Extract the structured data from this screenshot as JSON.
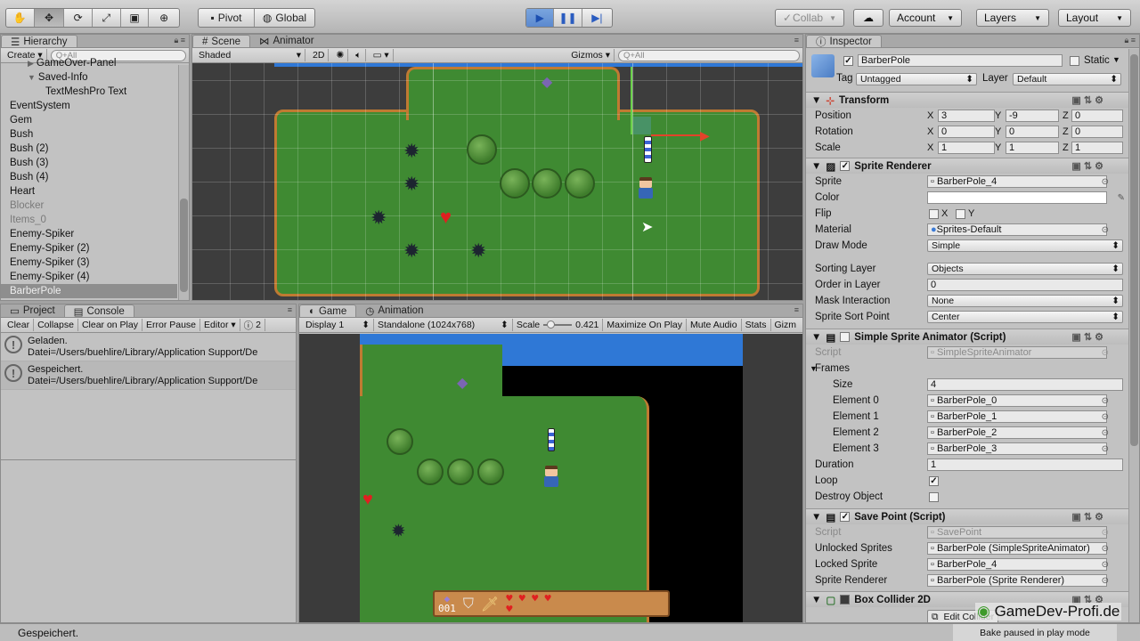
{
  "toolbar": {
    "pivot": "Pivot",
    "global": "Global",
    "collab": "Collab",
    "account": "Account",
    "layers": "Layers",
    "layout": "Layout"
  },
  "hierarchy": {
    "tab": "Hierarchy",
    "create": "Create",
    "search_placeholder": "Q+All",
    "items": [
      {
        "label": "GameOver-Panel",
        "indent": 3,
        "dim": false,
        "selected": false,
        "foldout": "▶"
      },
      {
        "label": "Saved-Info",
        "indent": 3,
        "dim": false,
        "selected": false,
        "foldout": "▼"
      },
      {
        "label": "TextMeshPro Text",
        "indent": 5,
        "dim": false,
        "selected": false,
        "foldout": ""
      },
      {
        "label": "EventSystem",
        "indent": 1,
        "dim": false,
        "selected": false,
        "foldout": ""
      },
      {
        "label": "Gem",
        "indent": 1,
        "dim": false,
        "selected": false,
        "foldout": ""
      },
      {
        "label": "Bush",
        "indent": 1,
        "dim": false,
        "selected": false,
        "foldout": ""
      },
      {
        "label": "Bush (2)",
        "indent": 1,
        "dim": false,
        "selected": false,
        "foldout": ""
      },
      {
        "label": "Bush (3)",
        "indent": 1,
        "dim": false,
        "selected": false,
        "foldout": ""
      },
      {
        "label": "Bush (4)",
        "indent": 1,
        "dim": false,
        "selected": false,
        "foldout": ""
      },
      {
        "label": "Heart",
        "indent": 1,
        "dim": false,
        "selected": false,
        "foldout": ""
      },
      {
        "label": "Blocker",
        "indent": 1,
        "dim": true,
        "selected": false,
        "foldout": ""
      },
      {
        "label": "Items_0",
        "indent": 1,
        "dim": true,
        "selected": false,
        "foldout": ""
      },
      {
        "label": "Enemy-Spiker",
        "indent": 1,
        "dim": false,
        "selected": false,
        "foldout": ""
      },
      {
        "label": "Enemy-Spiker (2)",
        "indent": 1,
        "dim": false,
        "selected": false,
        "foldout": ""
      },
      {
        "label": "Enemy-Spiker (3)",
        "indent": 1,
        "dim": false,
        "selected": false,
        "foldout": ""
      },
      {
        "label": "Enemy-Spiker (4)",
        "indent": 1,
        "dim": false,
        "selected": false,
        "foldout": ""
      },
      {
        "label": "BarberPole",
        "indent": 1,
        "dim": false,
        "selected": true,
        "foldout": ""
      }
    ]
  },
  "scene": {
    "tab_scene": "Scene",
    "tab_animator": "Animator",
    "shading": "Shaded",
    "mode2d": "2D",
    "gizmos": "Gizmos",
    "search_placeholder": "Q+All"
  },
  "console": {
    "tab_project": "Project",
    "tab_console": "Console",
    "clear": "Clear",
    "collapse": "Collapse",
    "clear_on_play": "Clear on Play",
    "error_pause": "Error Pause",
    "editor": "Editor",
    "count": "2",
    "entries": [
      {
        "title": "Geladen.",
        "detail": "Datei=/Users/buehlire/Library/Application Support/De"
      },
      {
        "title": "Gespeichert.",
        "detail": "Datei=/Users/buehlire/Library/Application Support/De"
      }
    ]
  },
  "game": {
    "tab_game": "Game",
    "tab_animation": "Animation",
    "display": "Display 1",
    "resolution": "Standalone (1024x768)",
    "scale_label": "Scale",
    "scale_value": "0.421",
    "maximize": "Maximize On Play",
    "mute": "Mute Audio",
    "stats": "Stats",
    "gizmos": "Gizm",
    "hud_count": "001"
  },
  "inspector": {
    "tab": "Inspector",
    "object_name": "BarberPole",
    "static_label": "Static",
    "tag_label": "Tag",
    "tag_value": "Untagged",
    "layer_label": "Layer",
    "layer_value": "Default",
    "transform": {
      "title": "Transform",
      "rows": [
        {
          "label": "Position",
          "x": "3",
          "y": "-9",
          "z": "0"
        },
        {
          "label": "Rotation",
          "x": "0",
          "y": "0",
          "z": "0"
        },
        {
          "label": "Scale",
          "x": "1",
          "y": "1",
          "z": "1"
        }
      ]
    },
    "sprite_renderer": {
      "title": "Sprite Renderer",
      "sprite_label": "Sprite",
      "sprite": "BarberPole_4",
      "color_label": "Color",
      "flip_label": "Flip",
      "flip_x": "X",
      "flip_y": "Y",
      "material_label": "Material",
      "material": "Sprites-Default",
      "draw_mode_label": "Draw Mode",
      "draw_mode": "Simple",
      "sorting_layer_label": "Sorting Layer",
      "sorting_layer": "Objects",
      "order_label": "Order in Layer",
      "order": "0",
      "mask_label": "Mask Interaction",
      "mask": "None",
      "sort_point_label": "Sprite Sort Point",
      "sort_point": "Center"
    },
    "simple_animator": {
      "title": "Simple Sprite Animator (Script)",
      "script_label": "Script",
      "script": "SimpleSpriteAnimator",
      "frames_label": "Frames",
      "size_label": "Size",
      "size": "4",
      "elements": [
        {
          "label": "Element 0",
          "value": "BarberPole_0"
        },
        {
          "label": "Element 1",
          "value": "BarberPole_1"
        },
        {
          "label": "Element 2",
          "value": "BarberPole_2"
        },
        {
          "label": "Element 3",
          "value": "BarberPole_3"
        }
      ],
      "duration_label": "Duration",
      "duration": "1",
      "loop_label": "Loop",
      "destroy_label": "Destroy Object"
    },
    "save_point": {
      "title": "Save Point (Script)",
      "script_label": "Script",
      "script": "SavePoint",
      "unlocked_label": "Unlocked Sprites",
      "unlocked": "BarberPole (SimpleSpriteAnimator)",
      "locked_label": "Locked Sprite",
      "locked": "BarberPole_4",
      "renderer_label": "Sprite Renderer",
      "renderer": "BarberPole (Sprite Renderer)"
    },
    "box_collider": {
      "title": "Box Collider 2D",
      "edit": "Edit Collider"
    },
    "watermark": "GameDev-Profi.de",
    "bake_status": "Bake paused in play mode"
  },
  "status": {
    "message": "Gespeichert."
  },
  "colors": {
    "play_active": "#5b89cf",
    "selection": "#8e8e8e",
    "grass": "#3f8a32",
    "water": "#2f78d6"
  }
}
